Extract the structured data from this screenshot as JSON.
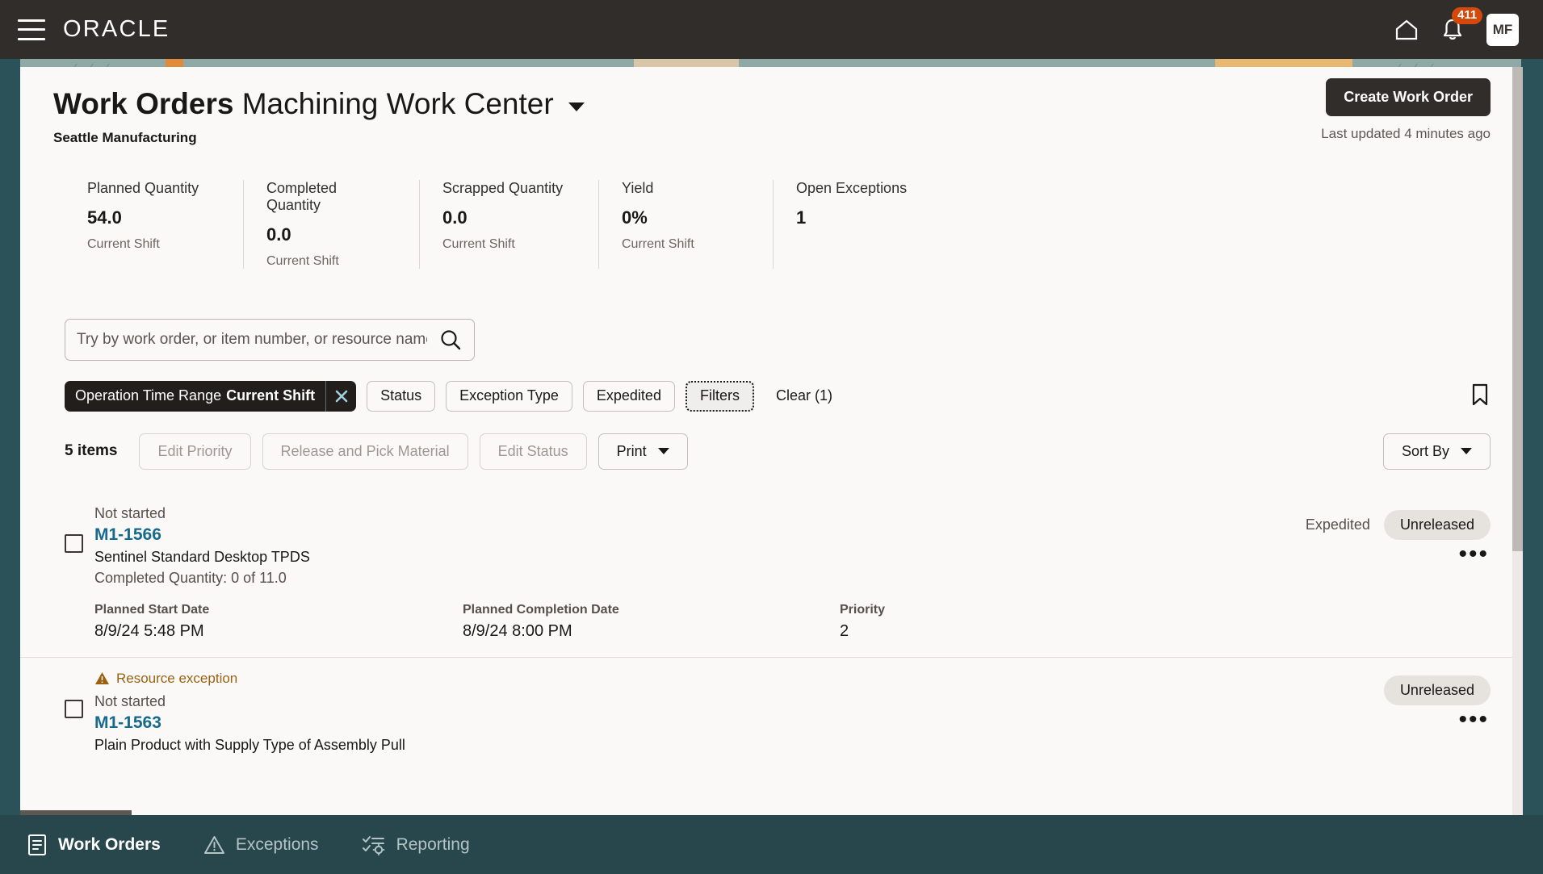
{
  "topbar": {
    "logo": "ORACLE",
    "menu_icon": "hamburger-icon",
    "home_icon": "home-icon",
    "bell_icon": "bell-icon",
    "notification_count": "411",
    "avatar_initials": "MF"
  },
  "header": {
    "title_bold": "Work Orders",
    "title_regular": "Machining Work Center",
    "subtitle": "Seattle Manufacturing",
    "create_button": "Create Work Order",
    "last_updated": "Last updated 4 minutes ago"
  },
  "kpis": [
    {
      "label": "Planned Quantity",
      "value": "54.0",
      "sub": "Current Shift"
    },
    {
      "label": "Completed Quantity",
      "value": "0.0",
      "sub": "Current Shift"
    },
    {
      "label": "Scrapped Quantity",
      "value": "0.0",
      "sub": "Current Shift"
    },
    {
      "label": "Yield",
      "value": "0%",
      "sub": "Current Shift"
    },
    {
      "label": "Open Exceptions",
      "value": "1",
      "sub": ""
    }
  ],
  "search": {
    "placeholder": "Try by work order, or item number, or resource name",
    "value": "",
    "icon": "search-icon"
  },
  "filters": {
    "active_chip_label": "Operation Time Range",
    "active_chip_value": "Current Shift",
    "remove_icon": "close-icon",
    "chips": [
      "Status",
      "Exception Type",
      "Expedited"
    ],
    "filters_button": "Filters",
    "clear_label": "Clear (1)",
    "bookmark_icon": "bookmark-icon"
  },
  "toolbar": {
    "items_count": "5 items",
    "edit_priority": "Edit Priority",
    "release_pick": "Release and Pick Material",
    "edit_status": "Edit Status",
    "print": "Print",
    "sort_by": "Sort By"
  },
  "list": {
    "meta_headers": {
      "start": "Planned Start Date",
      "completion": "Planned Completion Date",
      "priority": "Priority"
    },
    "rows": [
      {
        "exception": "",
        "status": "Not started",
        "work_order": "M1-1566",
        "item": "Sentinel Standard Desktop TPDS",
        "quantity": "Completed Quantity: 0 of 11.0",
        "expedited": "Expedited",
        "pill": "Unreleased",
        "planned_start": "8/9/24 5:48 PM",
        "planned_completion": "8/9/24 8:00 PM",
        "priority": "2"
      },
      {
        "exception": "Resource exception",
        "status": "Not started",
        "work_order": "M1-1563",
        "item": "Plain Product with Supply Type of Assembly Pull",
        "quantity": "",
        "expedited": "",
        "pill": "Unreleased",
        "planned_start": "",
        "planned_completion": "",
        "priority": ""
      }
    ]
  },
  "bottom_nav": [
    {
      "label": "Work Orders",
      "icon": "document-icon",
      "active": true
    },
    {
      "label": "Exceptions",
      "icon": "warning-triangle-icon",
      "active": false
    },
    {
      "label": "Reporting",
      "icon": "checklist-gear-icon",
      "active": false
    }
  ],
  "colors": {
    "topbar_bg": "#312d2a",
    "card_bg": "#faf9f8",
    "accent_link": "#176a8e",
    "badge": "#d4480b",
    "bottom_nav_bg": "#27474c",
    "exception": "#9a6110"
  }
}
